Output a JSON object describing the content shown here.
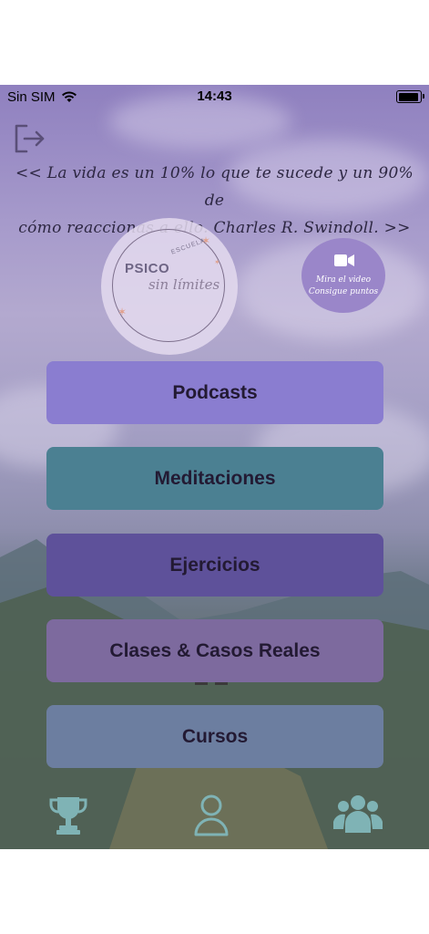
{
  "status": {
    "carrier": "Sin SIM",
    "time": "14:43"
  },
  "quote": {
    "line1": "<< La vida es un 10% lo que te sucede y un 90% de",
    "line2": "cómo reaccionas a ello. Charles R. Swindoll. >>"
  },
  "logo": {
    "escuela": "ESCUELA",
    "psico": "PSICO",
    "sin_limites": "sin límites"
  },
  "video": {
    "line1": "Mira el video",
    "line2": "Consigue puntos"
  },
  "menu": {
    "podcasts": "Podcasts",
    "meditaciones": "Meditaciones",
    "ejercicios": "Ejercicios",
    "clases": "Clases & Casos Reales",
    "cursos": "Cursos"
  },
  "colors": {
    "podcasts": "#8a7dd0",
    "meditaciones": "#4b8092",
    "ejercicios": "#5e519a",
    "clases": "#7d6a9e",
    "cursos": "#6c7ea0",
    "tab_icons": "#7fb3b5"
  },
  "icons": {
    "logout": "logout-icon",
    "video": "video-camera-icon",
    "trophy": "trophy-icon",
    "profile": "user-icon",
    "group": "group-icon"
  }
}
